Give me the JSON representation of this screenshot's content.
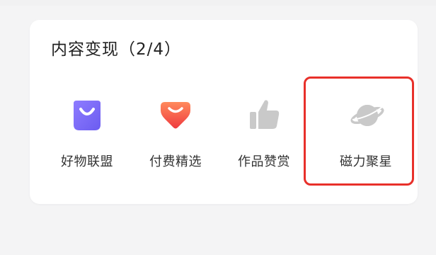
{
  "section": {
    "title": "内容变现（2/4）"
  },
  "items": [
    {
      "label": "好物联盟",
      "icon": "shopping-bag-icon",
      "color": "#7b6cf6",
      "enabled": true
    },
    {
      "label": "付费精选",
      "icon": "red-heart-bag-icon",
      "color": "#f24a3c",
      "enabled": true
    },
    {
      "label": "作品赞赏",
      "icon": "thumbs-up-icon",
      "color": "#c7c7c7",
      "enabled": false
    },
    {
      "label": "磁力聚星",
      "icon": "planet-icon",
      "color": "#c7c7c7",
      "enabled": false
    }
  ],
  "highlight": {
    "color": "#e8302a"
  }
}
